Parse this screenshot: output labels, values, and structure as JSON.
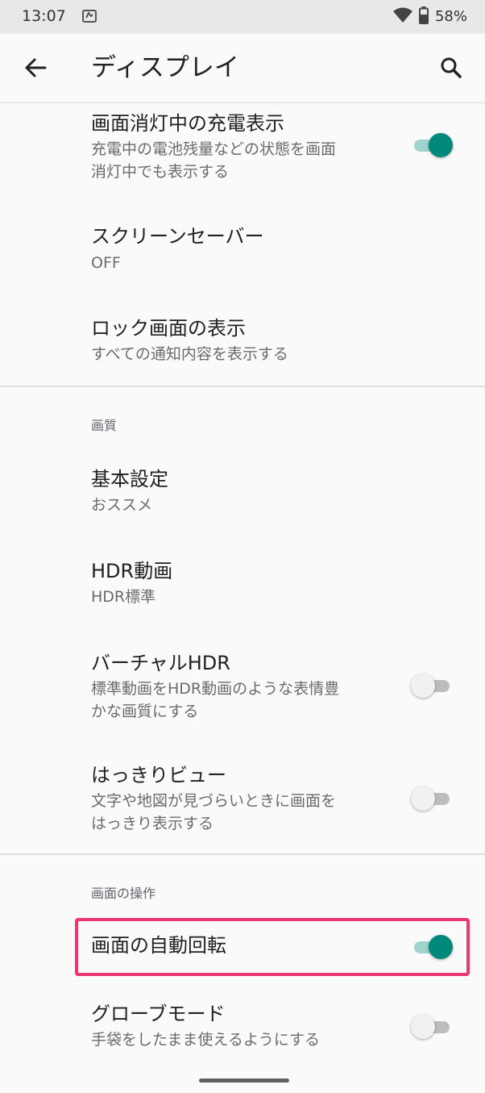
{
  "status_bar": {
    "time": "13:07",
    "battery": "58%",
    "icons": [
      "notification-icon",
      "wifi-icon",
      "battery-icon"
    ]
  },
  "app_bar": {
    "title": "ディスプレイ",
    "back_icon": "arrow-back-icon",
    "search_icon": "search-icon"
  },
  "items": {
    "ambient_charging": {
      "title": "画面消灯中の充電表示",
      "subtitle_line1": "充電中の電池残量などの状態を画面",
      "subtitle_line2": "消灯中でも表示する",
      "toggle": true
    },
    "screensaver": {
      "title": "スクリーンセーバー",
      "subtitle": "OFF"
    },
    "lock_screen": {
      "title": "ロック画面の表示",
      "subtitle": "すべての通知内容を表示する"
    },
    "basic_settings": {
      "title": "基本設定",
      "subtitle": "おススメ"
    },
    "hdr_video": {
      "title": "HDR動画",
      "subtitle": "HDR標準"
    },
    "virtual_hdr": {
      "title": "バーチャルHDR",
      "subtitle_line1": "標準動画をHDR動画のような表情豊",
      "subtitle_line2": "かな画質にする",
      "toggle": false
    },
    "clear_view": {
      "title": "はっきりビュー",
      "subtitle_line1": "文字や地図が見づらいときに画面を",
      "subtitle_line2": "はっきり表示する",
      "toggle": false
    },
    "auto_rotate": {
      "title": "画面の自動回転",
      "toggle": true
    },
    "glove_mode": {
      "title": "グローブモード",
      "subtitle": "手袋をしたまま使えるようにする",
      "toggle": false
    }
  },
  "sections": {
    "image_quality": "画質",
    "screen_operation": "画面の操作"
  },
  "colors": {
    "accent": "#00897b",
    "accent_track": "#9fd3cb",
    "highlight": "#ec3574",
    "background": "#fafafa"
  }
}
